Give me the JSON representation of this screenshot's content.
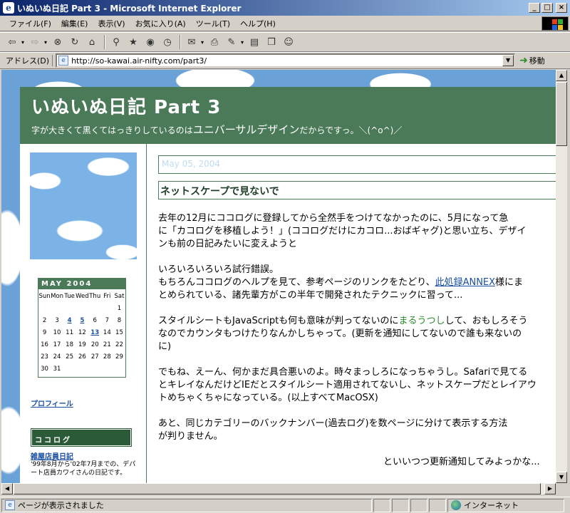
{
  "window": {
    "title": "いぬいぬ日記 Part 3 - Microsoft Internet Explorer",
    "minimize": "_",
    "maximize": "□",
    "close": "×"
  },
  "menu": [
    "ファイル(F)",
    "編集(E)",
    "表示(V)",
    "お気に入り(A)",
    "ツール(T)",
    "ヘルプ(H)"
  ],
  "address": {
    "label": "アドレス(D)",
    "url": "http://so-kawai.air-nifty.com/part3/",
    "go": "移動"
  },
  "blog": {
    "title": "いぬいぬ日記 Part 3",
    "subtitle_small_1": "字が大きくて黒くてはっきりしているのは",
    "subtitle_big": "ユニバーサルデザイン",
    "subtitle_small_2": "だからですっ。＼(^o^)／"
  },
  "calendar": {
    "month": "MAY 2004",
    "days_header": [
      "Sun",
      "Mon",
      "Tue",
      "Wed",
      "Thu",
      "Fri",
      "Sat"
    ],
    "weeks": [
      [
        "",
        "",
        "",
        "",
        "",
        "",
        "1"
      ],
      [
        "2",
        "3",
        "4",
        "5",
        "6",
        "7",
        "8"
      ],
      [
        "9",
        "10",
        "11",
        "12",
        "13",
        "14",
        "15"
      ],
      [
        "16",
        "17",
        "18",
        "19",
        "20",
        "21",
        "22"
      ],
      [
        "23",
        "24",
        "25",
        "26",
        "27",
        "28",
        "29"
      ],
      [
        "30",
        "31",
        "",
        "",
        "",
        "",
        ""
      ]
    ],
    "linked_days": [
      "4",
      "5",
      "13"
    ]
  },
  "sidebar": {
    "profile_link": "プロフィール",
    "cocolog_heading": "ココログ",
    "blog_link": "雑屋店員日記",
    "blog_desc": "'99年8月から'02年7月までの、デパート店員カワイさんの日記です。"
  },
  "post": {
    "date": "May 05, 2004",
    "title": "ネットスケープで見ないで",
    "p1": [
      "去年の12月にココログに登録してから全然手をつけてなかったのに、5月になって急",
      "に「カコログを移植しよう！」(ココログだけにカコロ...おばギャグ)と思い立ち、デザイ",
      "ンも前の日記みたいに変えようと"
    ],
    "p2_l1": "いろいろいろいろ試行錯誤。",
    "p2_l2a": "もちろんココログのヘルプを見て、参考ページのリンクをたどり、",
    "p2_link": "此処録ANNEX",
    "p2_l2b": "様にま",
    "p2_l3": "とめられている、諸先輩方がこの半年で開発されたテクニックに習って...",
    "p3_l1a": "スタイルシートもJavaScriptも何も意味が判ってないのに",
    "p3_green": "まるうつし",
    "p3_l1b": "して、おもしろそう",
    "p3_l2": "なのでカウンタもつけたりなんかしちゃって。(更新を通知にしてないので誰も来ないの",
    "p3_l3": "に)",
    "p4": [
      "でもね、えーん、何かまだ具合悪いのよ。時々まっしろになっちゃうし。Safariで見てる",
      "とキレイなんだけどIEだとスタイルシート適用されてないし、ネットスケープだとレイアウ",
      "トめちゃくちゃになっている。(以上すべてMacOSX)"
    ],
    "p5": [
      "あと、同じカテゴリーのバックナンバー(過去ログ)を数ページに分けて表示する方法",
      "が判りません。"
    ],
    "p6": "といいつつ更新通知してみよっかな..."
  },
  "status": {
    "text": "ページが表示されました",
    "zone": "インターネット"
  }
}
